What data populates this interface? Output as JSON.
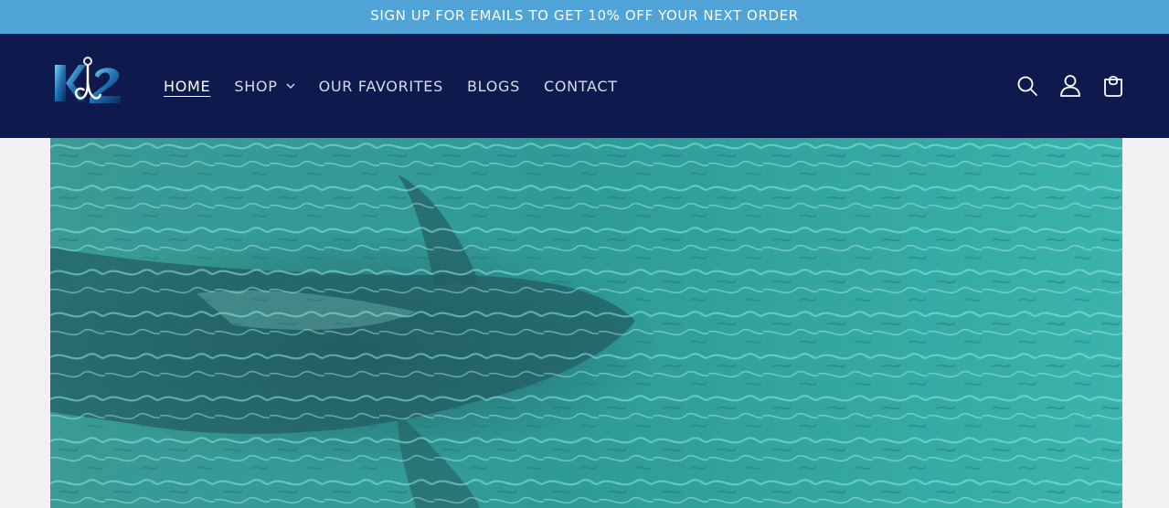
{
  "announcement": {
    "text": "SIGN UP FOR EMAILS TO GET 10% OFF YOUR NEXT ORDER"
  },
  "header": {
    "logo_icon": "hook-wave-logo",
    "nav": [
      {
        "label": "HOME",
        "active": true
      },
      {
        "label": "SHOP",
        "has_dropdown": true
      },
      {
        "label": "OUR FAVORITES"
      },
      {
        "label": "BLOGS"
      },
      {
        "label": "CONTACT"
      }
    ],
    "icons": [
      "search-icon",
      "account-icon",
      "cart-icon"
    ]
  },
  "hero": {
    "image_description": "shark-underwater-image"
  },
  "colors": {
    "announcement_bg": "#4fa3d6",
    "header_bg": "#0e1a4d",
    "page_bg": "#f1f1f4",
    "water": "#2a8f8c"
  }
}
